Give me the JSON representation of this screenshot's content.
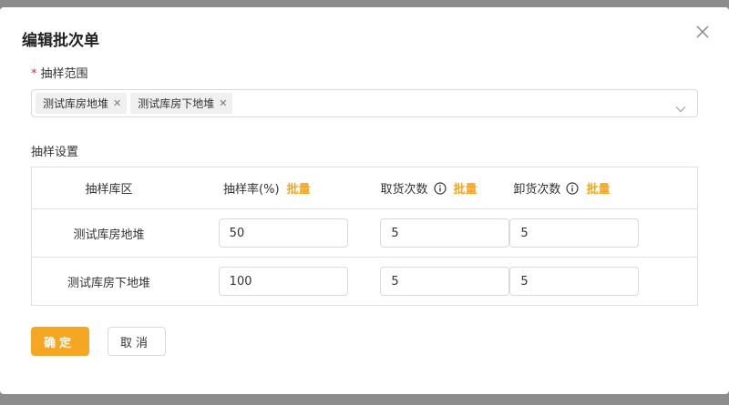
{
  "dialog": {
    "title": "编辑批次单"
  },
  "sampling_scope": {
    "required_mark": "*",
    "label": "抽样范围",
    "tags": [
      "测试库房地堆",
      "测试库房下地堆"
    ]
  },
  "settings": {
    "label": "抽样设置",
    "headers": {
      "area": "抽样库区",
      "rate": "抽样率(%)",
      "pick_count": "取货次数",
      "unload_count": "卸货次数",
      "batch": "批量"
    },
    "rows": [
      {
        "area": "测试库房地堆",
        "rate": "50",
        "pick_count": "5",
        "unload_count": "5"
      },
      {
        "area": "测试库房下地堆",
        "rate": "100",
        "pick_count": "5",
        "unload_count": "5"
      }
    ]
  },
  "buttons": {
    "ok": "确定",
    "cancel": "取消"
  },
  "icons": {
    "close": "close-icon",
    "tag_remove": "close-icon",
    "dropdown": "chevron-down-icon",
    "info": "info-icon"
  },
  "colors": {
    "accent": "#f5a623",
    "required": "#f5222d"
  }
}
